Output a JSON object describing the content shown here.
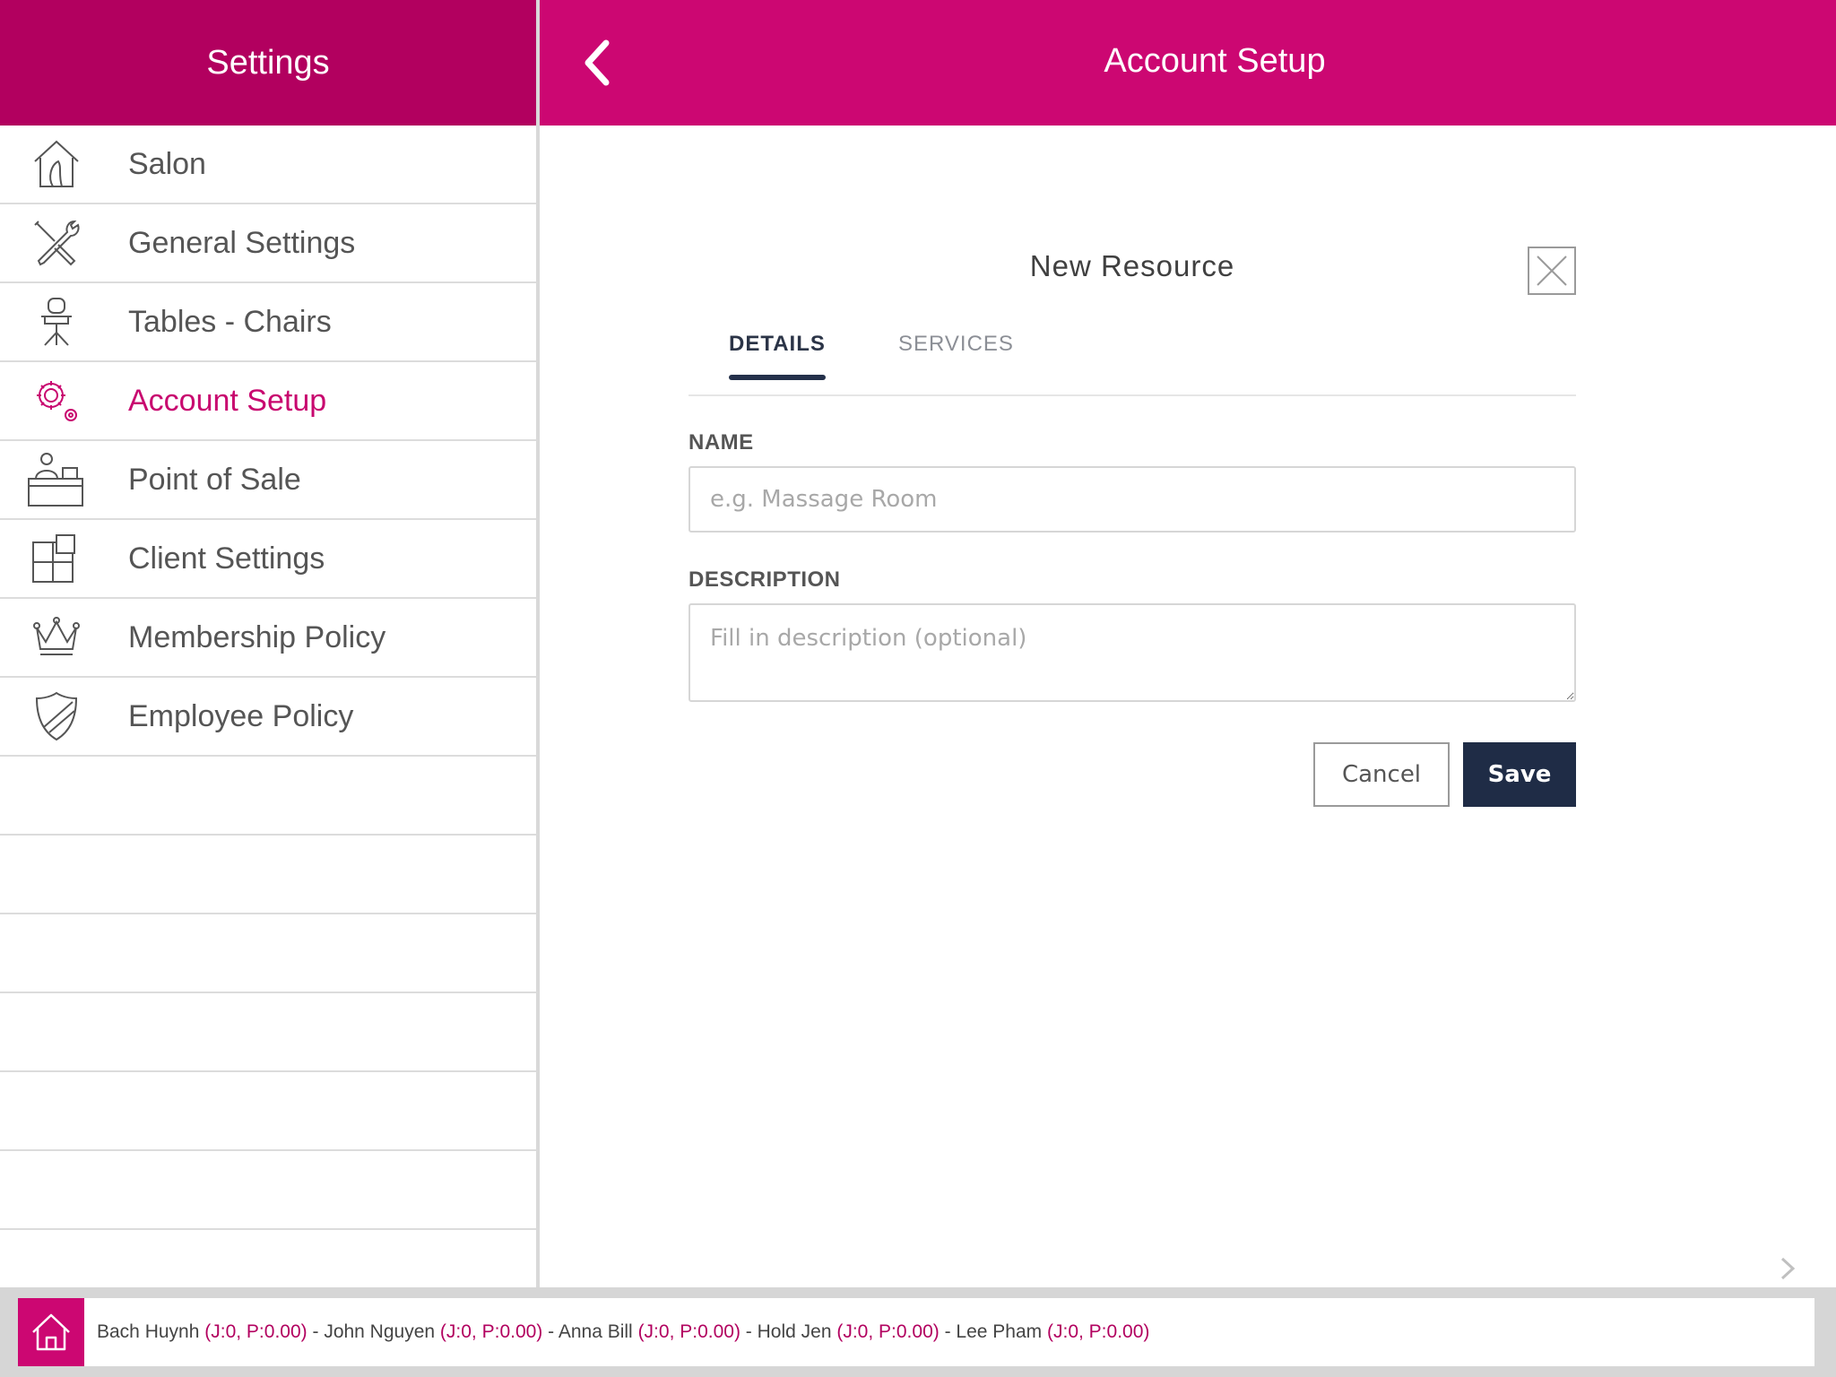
{
  "sidebar": {
    "title": "Settings",
    "items": [
      {
        "label": "Salon",
        "icon": "salon-house-icon"
      },
      {
        "label": "General Settings",
        "icon": "tools-icon"
      },
      {
        "label": "Tables - Chairs",
        "icon": "chair-icon"
      },
      {
        "label": "Account Setup",
        "icon": "gears-icon",
        "active": true
      },
      {
        "label": "Point of Sale",
        "icon": "cashier-icon"
      },
      {
        "label": "Client Settings",
        "icon": "blocks-icon"
      },
      {
        "label": "Membership Policy",
        "icon": "crown-icon"
      },
      {
        "label": "Employee Policy",
        "icon": "shield-icon"
      }
    ]
  },
  "header": {
    "title": "Account Setup"
  },
  "dialog": {
    "title": "New Resource",
    "tabs": [
      {
        "label": "DETAILS",
        "active": true
      },
      {
        "label": "SERVICES",
        "active": false
      }
    ],
    "name_label": "NAME",
    "name_placeholder": "e.g. Massage Room",
    "name_value": "",
    "description_label": "DESCRIPTION",
    "description_placeholder": "Fill in description (optional)",
    "description_value": "",
    "cancel_label": "Cancel",
    "save_label": "Save"
  },
  "footer": {
    "staff": [
      {
        "name": "Bach Huynh",
        "stats": "(J:0, P:0.00)"
      },
      {
        "name": "John Nguyen",
        "stats": "(J:0, P:0.00)"
      },
      {
        "name": "Anna Bill",
        "stats": "(J:0, P:0.00)"
      },
      {
        "name": "Hold Jen",
        "stats": "(J:0, P:0.00)"
      },
      {
        "name": "Lee Pham",
        "stats": "(J:0, P:0.00)"
      }
    ],
    "separator": " - "
  },
  "colors": {
    "brand": "#cc0772",
    "brand_dark": "#b2005f",
    "navy": "#1f2c46"
  }
}
